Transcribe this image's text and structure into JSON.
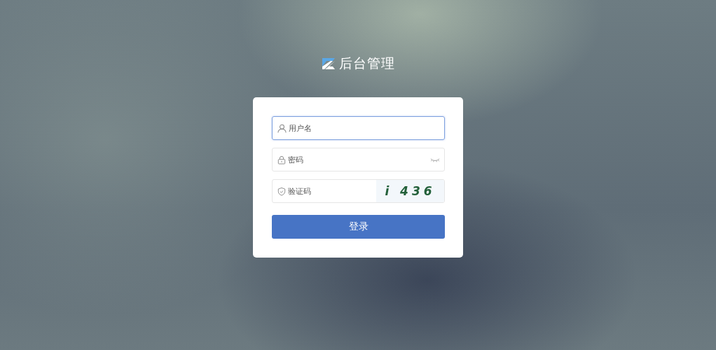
{
  "logo": {
    "title": "后台管理"
  },
  "form": {
    "fields": [
      {
        "kind": "username",
        "placeholder": "用户名",
        "focused": true
      },
      {
        "kind": "password",
        "placeholder": "密码",
        "focused": false
      },
      {
        "kind": "captcha",
        "placeholder": "验证码",
        "focused": false,
        "captcha": "i 436"
      }
    ],
    "submit": "登录"
  }
}
